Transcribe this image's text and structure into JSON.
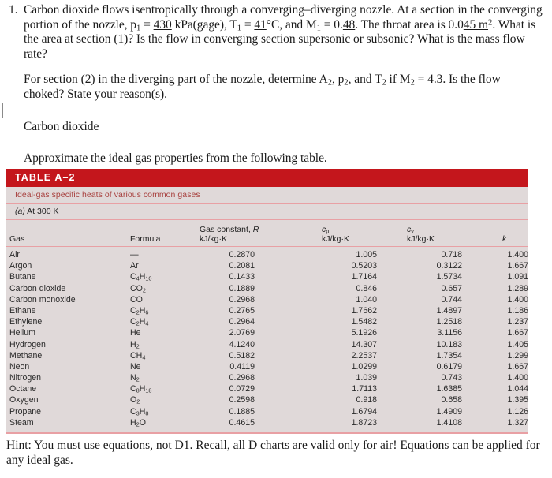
{
  "problem": {
    "number": "1.",
    "paragraph1_parts": [
      {
        "t": "Carbon dioxide flows isentropically through a converging–diverging nozzle. At a section in the converging portion of the nozzle, p",
        "u": false
      },
      {
        "t": "1",
        "sub": true
      },
      {
        "t": " = ",
        "u": false
      },
      {
        "t": "430",
        "u": true
      },
      {
        "t": " kPa(gage), T",
        "u": false
      },
      {
        "t": "1",
        "sub": true
      },
      {
        "t": " = ",
        "u": false
      },
      {
        "t": "41",
        "u": true
      },
      {
        "t": "°C, and M",
        "u": false
      },
      {
        "t": "1",
        "sub": true
      },
      {
        "t": " = 0.",
        "u": false
      },
      {
        "t": "48",
        "u": true
      },
      {
        "t": ". The throat area is 0.0",
        "u": false
      },
      {
        "t": "45 m",
        "u": true
      },
      {
        "t": "2",
        "sup": true
      },
      {
        "t": ". What is the area at section (1)? Is the flow in converging section supersonic or subsonic? What is the mass flow rate?",
        "u": false
      }
    ],
    "paragraph2_parts": [
      {
        "t": "For section (2) in the diverging part of the nozzle, determine A",
        "u": false
      },
      {
        "t": "2",
        "sub": true
      },
      {
        "t": ", p",
        "u": false
      },
      {
        "t": "2",
        "sub": true
      },
      {
        "t": ", and T",
        "u": false
      },
      {
        "t": "2",
        "sub": true
      },
      {
        "t": " if M",
        "u": false
      },
      {
        "t": "2",
        "sub": true
      },
      {
        "t": " = ",
        "u": false
      },
      {
        "t": "4.3",
        "u": true
      },
      {
        "t": ". Is the flow choked? State your reason(s).",
        "u": false
      }
    ],
    "paragraph3": "Carbon dioxide",
    "paragraph4": "Approximate the ideal gas properties from the following table.",
    "hint": "Hint: You must use equations, not D1. Recall, all D charts are valid only for air! Equations can be applied for any ideal gas."
  },
  "table": {
    "title": "TABLE A–2",
    "subtitle": "Ideal-gas specific heats of various common gases",
    "section_label_a": "(a)",
    "section_label_rest": " At 300 K",
    "headers": {
      "gas": "Gas",
      "formula": "Formula",
      "R_name": "Gas constant, ",
      "R_symbol": "R",
      "R_unit": "kJ/kg·K",
      "cp_symbol": "c",
      "cp_sub": "p",
      "cp_unit": "kJ/kg·K",
      "cv_symbol": "c",
      "cv_sub": "v",
      "cv_unit": "kJ/kg·K",
      "k": "k"
    },
    "colors": {
      "header_red": "#c4161c",
      "rule_pink": "#e8a0a4",
      "body_bg": "#e0d9d9",
      "subtitle_text": "#a8413f"
    },
    "rows": [
      {
        "gas": "Air",
        "formula": "—",
        "formula_sub": "",
        "formula2": "",
        "formula2_sub": "",
        "R": "0.2870",
        "cp": "1.005",
        "cv": "0.718",
        "k": "1.400"
      },
      {
        "gas": "Argon",
        "formula": "Ar",
        "formula_sub": "",
        "formula2": "",
        "formula2_sub": "",
        "R": "0.2081",
        "cp": "0.5203",
        "cv": "0.3122",
        "k": "1.667"
      },
      {
        "gas": "Butane",
        "formula": "C",
        "formula_sub": "4",
        "formula2": "H",
        "formula2_sub": "10",
        "R": "0.1433",
        "cp": "1.7164",
        "cv": "1.5734",
        "k": "1.091"
      },
      {
        "gas": "Carbon dioxide",
        "formula": "CO",
        "formula_sub": "2",
        "formula2": "",
        "formula2_sub": "",
        "R": "0.1889",
        "cp": "0.846",
        "cv": "0.657",
        "k": "1.289"
      },
      {
        "gas": "Carbon monoxide",
        "formula": "CO",
        "formula_sub": "",
        "formula2": "",
        "formula2_sub": "",
        "R": "0.2968",
        "cp": "1.040",
        "cv": "0.744",
        "k": "1.400"
      },
      {
        "gas": "Ethane",
        "formula": "C",
        "formula_sub": "2",
        "formula2": "H",
        "formula2_sub": "6",
        "R": "0.2765",
        "cp": "1.7662",
        "cv": "1.4897",
        "k": "1.186"
      },
      {
        "gas": "Ethylene",
        "formula": "C",
        "formula_sub": "2",
        "formula2": "H",
        "formula2_sub": "4",
        "R": "0.2964",
        "cp": "1.5482",
        "cv": "1.2518",
        "k": "1.237"
      },
      {
        "gas": "Helium",
        "formula": "He",
        "formula_sub": "",
        "formula2": "",
        "formula2_sub": "",
        "R": "2.0769",
        "cp": "5.1926",
        "cv": "3.1156",
        "k": "1.667"
      },
      {
        "gas": "Hydrogen",
        "formula": "H",
        "formula_sub": "2",
        "formula2": "",
        "formula2_sub": "",
        "R": "4.1240",
        "cp": "14.307",
        "cv": "10.183",
        "k": "1.405"
      },
      {
        "gas": "Methane",
        "formula": "CH",
        "formula_sub": "4",
        "formula2": "",
        "formula2_sub": "",
        "R": "0.5182",
        "cp": "2.2537",
        "cv": "1.7354",
        "k": "1.299"
      },
      {
        "gas": "Neon",
        "formula": "Ne",
        "formula_sub": "",
        "formula2": "",
        "formula2_sub": "",
        "R": "0.4119",
        "cp": "1.0299",
        "cv": "0.6179",
        "k": "1.667"
      },
      {
        "gas": "Nitrogen",
        "formula": "N",
        "formula_sub": "2",
        "formula2": "",
        "formula2_sub": "",
        "R": "0.2968",
        "cp": "1.039",
        "cv": "0.743",
        "k": "1.400"
      },
      {
        "gas": "Octane",
        "formula": "C",
        "formula_sub": "8",
        "formula2": "H",
        "formula2_sub": "18",
        "R": "0.0729",
        "cp": "1.7113",
        "cv": "1.6385",
        "k": "1.044"
      },
      {
        "gas": "Oxygen",
        "formula": "O",
        "formula_sub": "2",
        "formula2": "",
        "formula2_sub": "",
        "R": "0.2598",
        "cp": "0.918",
        "cv": "0.658",
        "k": "1.395"
      },
      {
        "gas": "Propane",
        "formula": "C",
        "formula_sub": "3",
        "formula2": "H",
        "formula2_sub": "8",
        "R": "0.1885",
        "cp": "1.6794",
        "cv": "1.4909",
        "k": "1.126"
      },
      {
        "gas": "Steam",
        "formula": "H",
        "formula_sub": "2",
        "formula2": "O",
        "formula2_sub": "",
        "R": "0.4615",
        "cp": "1.8723",
        "cv": "1.4108",
        "k": "1.327"
      }
    ]
  }
}
